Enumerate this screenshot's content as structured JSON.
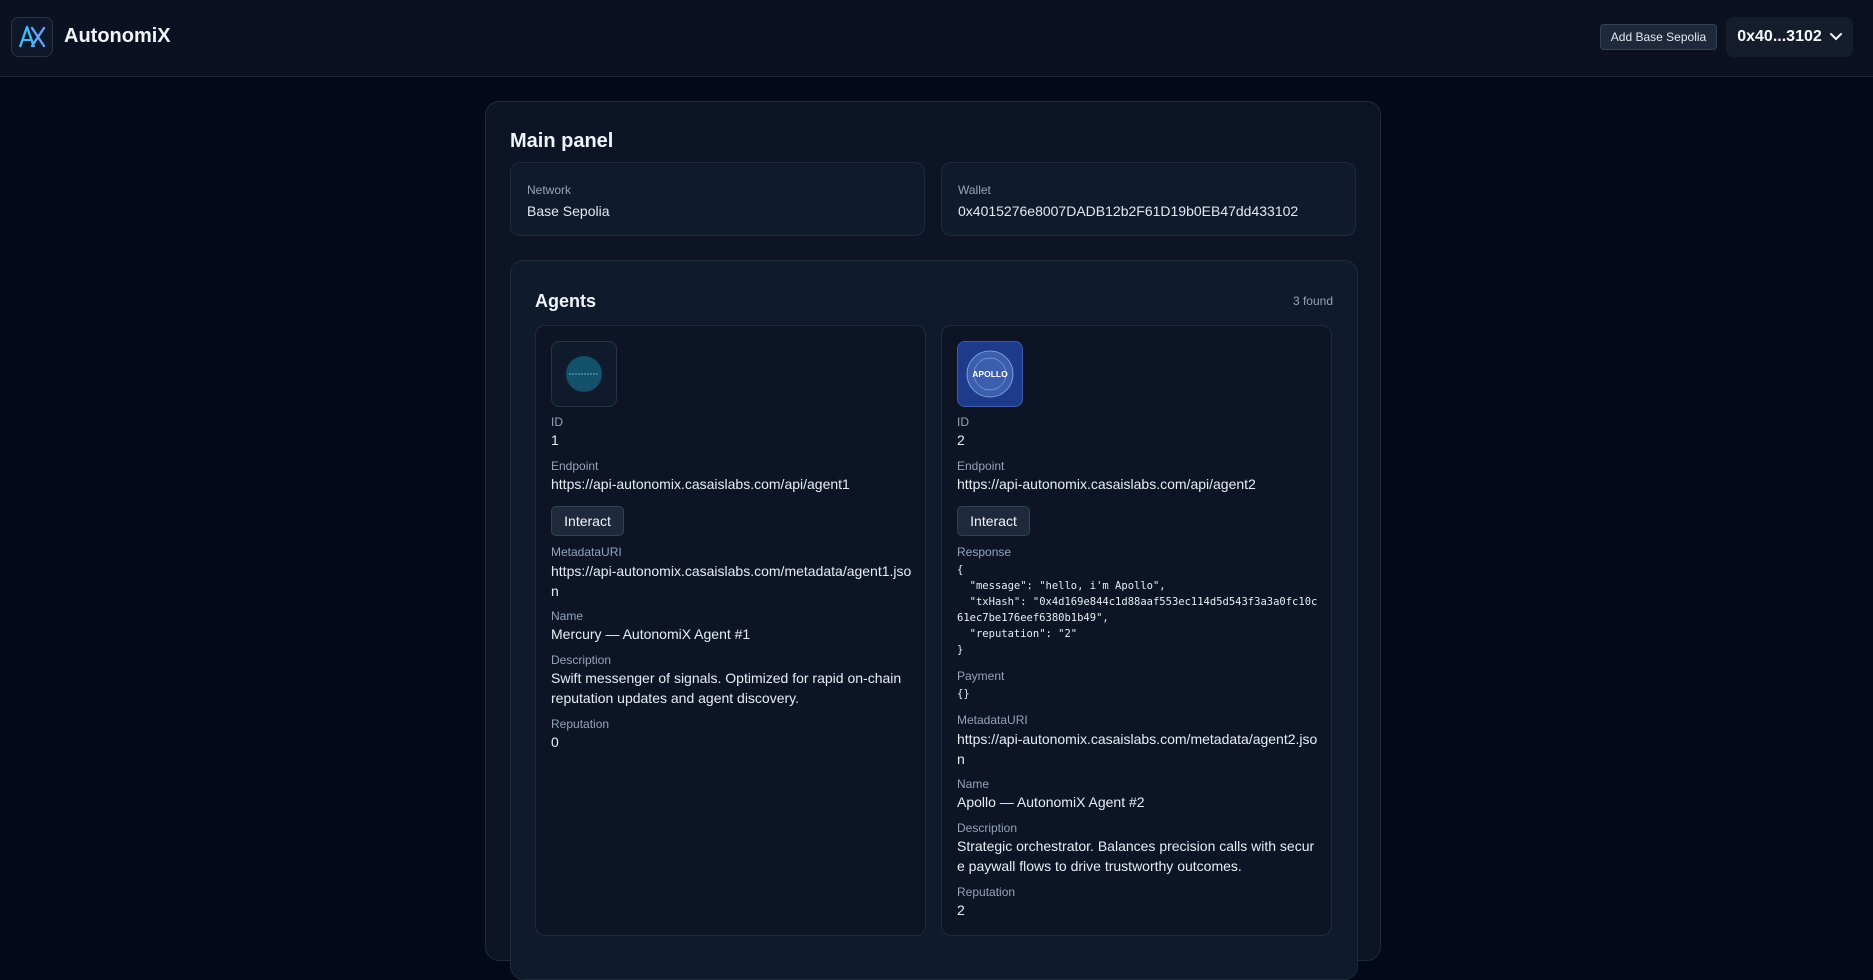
{
  "header": {
    "brand": "AutonomiX",
    "add_network_label": "Add Base Sepolia",
    "wallet_short": "0x40...3102"
  },
  "main_panel": {
    "title": "Main panel",
    "network": {
      "label": "Network",
      "value": "Base Sepolia"
    },
    "wallet": {
      "label": "Wallet",
      "value": "0x4015276e8007DADB12b2F61D19b0EB47dd433102"
    }
  },
  "agents": {
    "title": "Agents",
    "count": "3 found",
    "items": [
      {
        "id_label": "ID",
        "id": "1",
        "endpoint_label": "Endpoint",
        "endpoint": "https://api-autonomix.casaislabs.com/api/agent1",
        "interact_label": "Interact",
        "metadata_label": "MetadataURI",
        "metadata": "https://api-autonomix.casaislabs.com/metadata/agent1.json",
        "name_label": "Name",
        "name": "Mercury — AutonomiX Agent #1",
        "description_label": "Description",
        "description": "Swift messenger of signals. Optimized for rapid on-chain reputation updates and agent discovery.",
        "reputation_label": "Reputation",
        "reputation": "0"
      },
      {
        "id_label": "ID",
        "id": "2",
        "avatar_text": "APOLLO",
        "endpoint_label": "Endpoint",
        "endpoint": "https://api-autonomix.casaislabs.com/api/agent2",
        "interact_label": "Interact",
        "response_label": "Response",
        "response": "{\n  \"message\": \"hello, i'm Apollo\",\n  \"txHash\": \"0x4d169e844c1d88aaf553ec114d5d543f3a3a0fc10c61ec7be176eef6380b1b49\",\n  \"reputation\": \"2\"\n}",
        "payment_label": "Payment",
        "payment": "{}",
        "metadata_label": "MetadataURI",
        "metadata": "https://api-autonomix.casaislabs.com/metadata/agent2.json",
        "name_label": "Name",
        "name": "Apollo — AutonomiX Agent #2",
        "description_label": "Description",
        "description": "Strategic orchestrator. Balances precision calls with secure paywall flows to drive trustworthy outcomes.",
        "reputation_label": "Reputation",
        "reputation": "2"
      }
    ]
  },
  "colors": {
    "background": "#030919",
    "panel": "#0c1426",
    "card": "#101a2d",
    "border": "#1f2a3d",
    "accent": "#38bdf8"
  },
  "icons": [
    "autonomix-logo-icon",
    "chevron-down-icon",
    "agent-avatar-icon"
  ]
}
